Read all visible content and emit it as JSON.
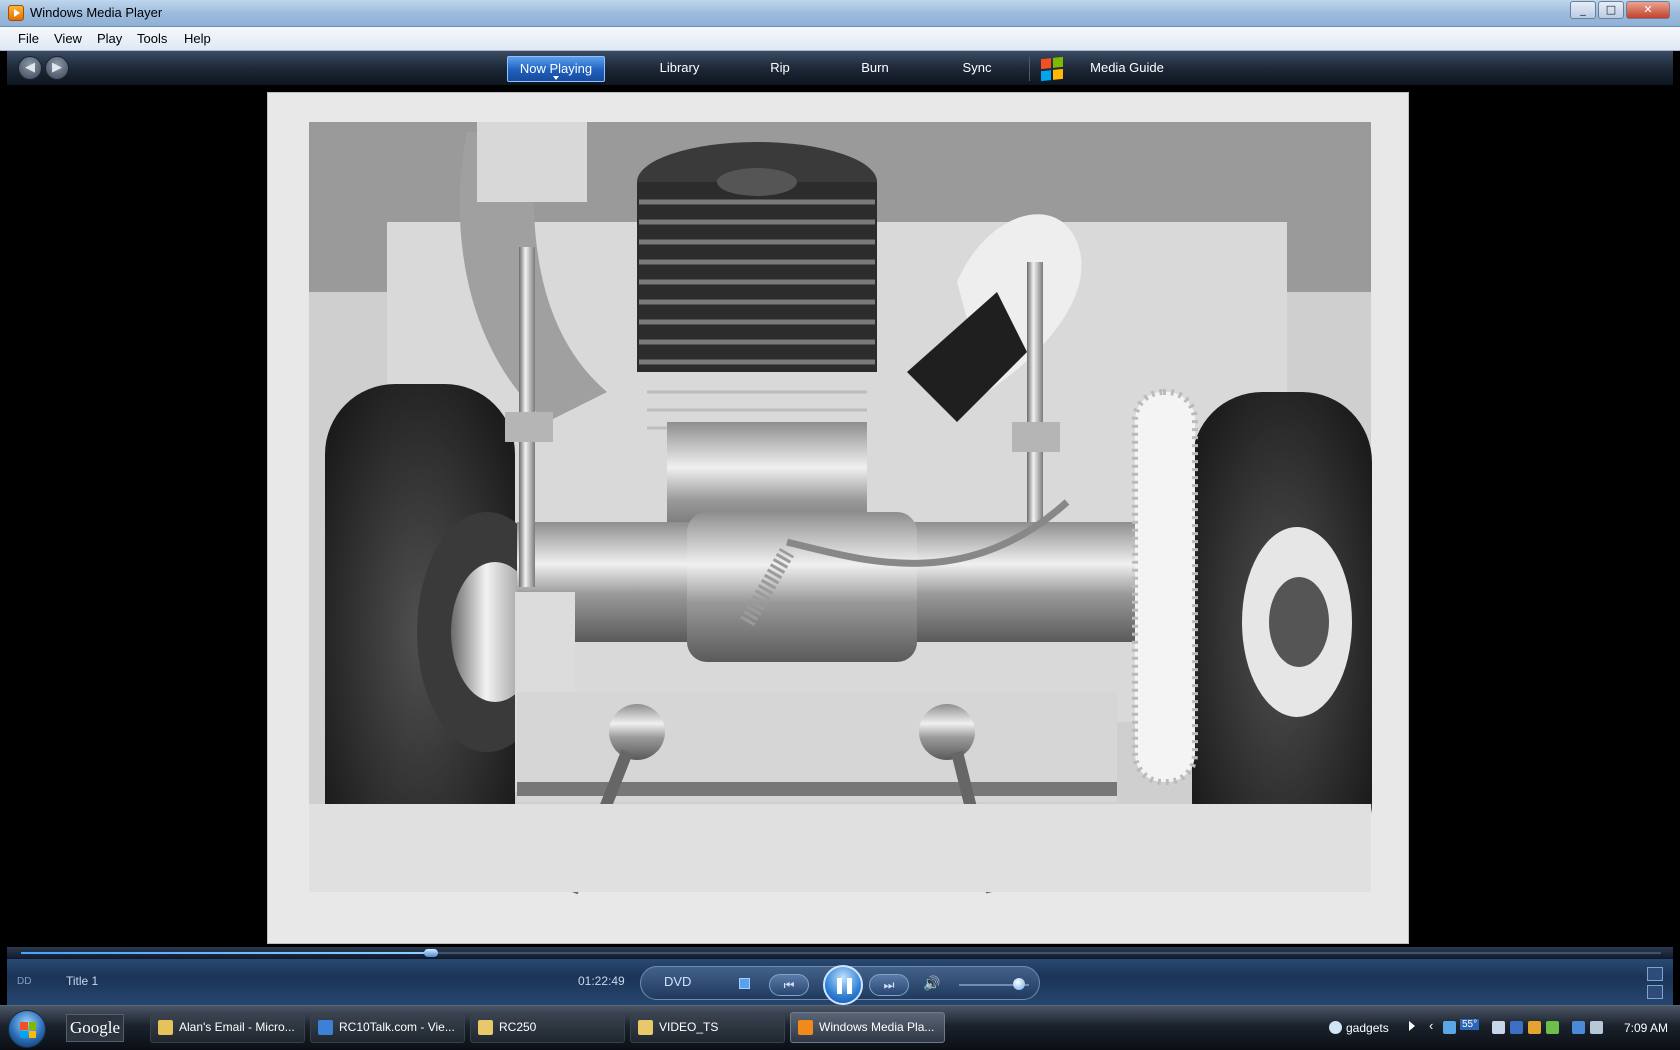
{
  "window": {
    "title": "Windows Media Player"
  },
  "menu": {
    "items": [
      "File",
      "View",
      "Play",
      "Tools",
      "Help"
    ]
  },
  "nav": {
    "tabs": [
      "Now Playing",
      "Library",
      "Rip",
      "Burn",
      "Sync"
    ],
    "media_guide": "Media Guide",
    "active_tab": "Now Playing"
  },
  "video": {
    "content": "black-and-white photo of RC car engine"
  },
  "playback": {
    "progress": 0.25,
    "title_label": "Title 1",
    "time": "01:22:49",
    "mode_label": "DVD",
    "volume": 0.85
  },
  "taskbar": {
    "search_label": "Google",
    "items": [
      {
        "label": "Alan's Email - Micro...",
        "icon_color": "#e6c35a"
      },
      {
        "label": "RC10Talk.com - Vie...",
        "icon_color": "#3b82d6"
      },
      {
        "label": "RC250",
        "icon_color": "#e8c86a"
      },
      {
        "label": "VIDEO_TS",
        "icon_color": "#e8c86a"
      },
      {
        "label": "Windows Media Pla...",
        "icon_color": "#f08a1a"
      }
    ],
    "tray": {
      "gadgets_label": "gadgets",
      "temperature": "55°",
      "clock": "7:09 AM"
    }
  },
  "colors": {
    "accent_blue": "#1f5fbd",
    "title_bar": "#9dbcdc",
    "control_bar": "#1b3356"
  }
}
